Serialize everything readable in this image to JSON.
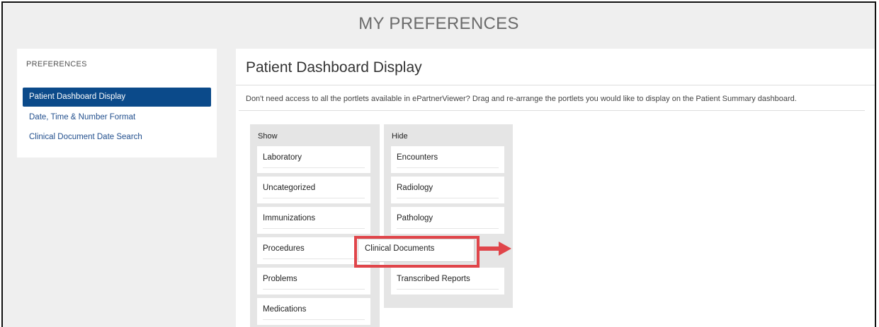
{
  "header": {
    "title": "MY PREFERENCES"
  },
  "sidebar": {
    "heading": "PREFERENCES",
    "items": [
      {
        "label": "Patient Dashboard Display",
        "active": true
      },
      {
        "label": "Date, Time & Number Format",
        "active": false
      },
      {
        "label": "Clinical Document Date Search",
        "active": false
      }
    ]
  },
  "main": {
    "title": "Patient Dashboard Display",
    "description": "Don't need access to all the portlets available in ePartnerViewer? Drag and re-arrange the portlets you would like to display on the Patient Summary dashboard.",
    "show": {
      "label": "Show",
      "items": [
        "Laboratory",
        "Uncategorized",
        "Immunizations",
        "Procedures",
        "Problems",
        "Medications"
      ]
    },
    "hide": {
      "label": "Hide",
      "items": [
        "Encounters",
        "Radiology",
        "Pathology",
        "Transcribed Reports"
      ]
    },
    "dragging": {
      "label": "Clinical Documents"
    }
  },
  "colors": {
    "accent": "#0b4a8a",
    "link": "#23508e",
    "highlight": "#e0454a",
    "page_bg": "#efefef",
    "column_bg": "#e5e5e5"
  },
  "icons": {
    "drag_arrow": "right-arrow-icon"
  }
}
